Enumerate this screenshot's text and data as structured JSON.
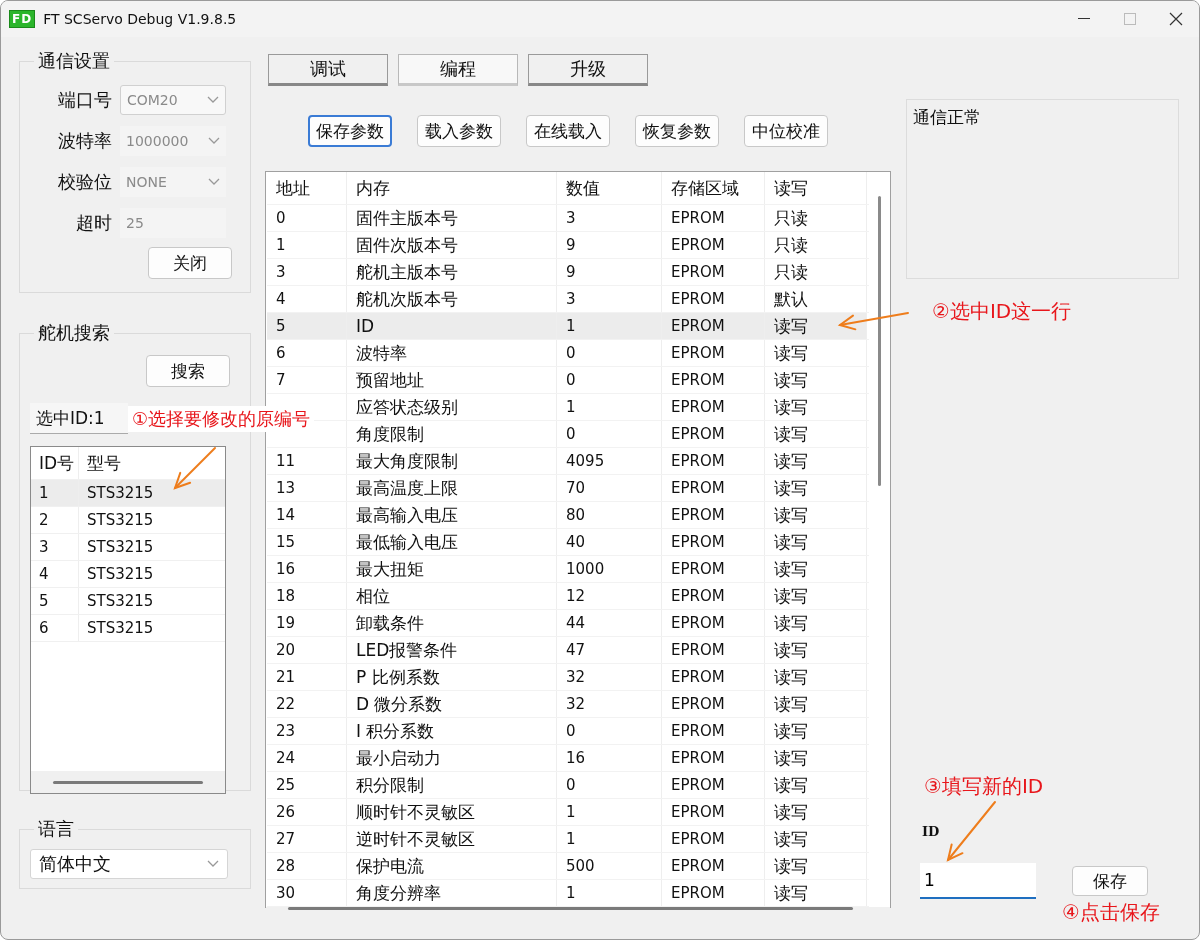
{
  "window": {
    "logo": "FD",
    "title": "FT SCServo Debug V1.9.8.5"
  },
  "comm_settings": {
    "title": "通信设置",
    "fields": [
      {
        "label": "端口号",
        "value": "COM20",
        "kind": "dropdown",
        "disabled": false
      },
      {
        "label": "波特率",
        "value": "1000000",
        "kind": "dropdown",
        "disabled": true
      },
      {
        "label": "校验位",
        "value": "NONE",
        "kind": "dropdown",
        "disabled": true
      },
      {
        "label": "超时",
        "value": "25",
        "kind": "text",
        "disabled": true
      }
    ],
    "button": "关闭"
  },
  "servo_search": {
    "title": "舵机搜索",
    "button": "搜索",
    "selected_id": "选中ID:1",
    "columns": [
      "ID号",
      "型号"
    ],
    "rows": [
      {
        "id": "1",
        "model": "STS3215",
        "selected": true
      },
      {
        "id": "2",
        "model": "STS3215",
        "selected": false
      },
      {
        "id": "3",
        "model": "STS3215",
        "selected": false
      },
      {
        "id": "4",
        "model": "STS3215",
        "selected": false
      },
      {
        "id": "5",
        "model": "STS3215",
        "selected": false
      },
      {
        "id": "6",
        "model": "STS3215",
        "selected": false
      }
    ]
  },
  "language": {
    "title": "语言",
    "value": "简体中文"
  },
  "tabs": [
    {
      "label": "调试",
      "selected": false
    },
    {
      "label": "编程",
      "selected": true
    },
    {
      "label": "升级",
      "selected": false
    }
  ],
  "actions": [
    {
      "label": "保存参数",
      "focused": true
    },
    {
      "label": "载入参数",
      "focused": false
    },
    {
      "label": "在线载入",
      "focused": false
    },
    {
      "label": "恢复参数",
      "focused": false
    },
    {
      "label": "中位校准",
      "focused": false
    }
  ],
  "table": {
    "columns": [
      "地址",
      "内存",
      "数值",
      "存储区域",
      "读写"
    ],
    "rows": [
      {
        "address": "0",
        "memory": "固件主版本号",
        "value": "3",
        "area": "EPROM",
        "access": "只读",
        "selected": false
      },
      {
        "address": "1",
        "memory": "固件次版本号",
        "value": "9",
        "area": "EPROM",
        "access": "只读",
        "selected": false
      },
      {
        "address": "3",
        "memory": "舵机主版本号",
        "value": "9",
        "area": "EPROM",
        "access": "只读",
        "selected": false
      },
      {
        "address": "4",
        "memory": "舵机次版本号",
        "value": "3",
        "area": "EPROM",
        "access": "默认",
        "selected": false
      },
      {
        "address": "5",
        "memory": "ID",
        "value": "1",
        "area": "EPROM",
        "access": "读写",
        "selected": true
      },
      {
        "address": "6",
        "memory": "波特率",
        "value": "0",
        "area": "EPROM",
        "access": "读写",
        "selected": false
      },
      {
        "address": "7",
        "memory": "预留地址",
        "value": "0",
        "area": "EPROM",
        "access": "读写",
        "selected": false
      },
      {
        "memory": "应答状态级别",
        "value": "1",
        "area": "EPROM",
        "access": "读写",
        "selected": false
      },
      {
        "memory": "角度限制",
        "value": "0",
        "area": "EPROM",
        "access": "读写",
        "selected": false
      },
      {
        "address": "11",
        "memory": "最大角度限制",
        "value": "4095",
        "area": "EPROM",
        "access": "读写",
        "selected": false
      },
      {
        "address": "13",
        "memory": "最高温度上限",
        "value": "70",
        "area": "EPROM",
        "access": "读写",
        "selected": false
      },
      {
        "address": "14",
        "memory": "最高输入电压",
        "value": "80",
        "area": "EPROM",
        "access": "读写",
        "selected": false
      },
      {
        "address": "15",
        "memory": "最低输入电压",
        "value": "40",
        "area": "EPROM",
        "access": "读写",
        "selected": false
      },
      {
        "address": "16",
        "memory": "最大扭矩",
        "value": "1000",
        "area": "EPROM",
        "access": "读写",
        "selected": false
      },
      {
        "address": "18",
        "memory": "相位",
        "value": "12",
        "area": "EPROM",
        "access": "读写",
        "selected": false
      },
      {
        "address": "19",
        "memory": "卸载条件",
        "value": "44",
        "area": "EPROM",
        "access": "读写",
        "selected": false
      },
      {
        "address": "20",
        "memory": "LED报警条件",
        "value": "47",
        "area": "EPROM",
        "access": "读写",
        "selected": false
      },
      {
        "address": "21",
        "memory": "P 比例系数",
        "value": "32",
        "area": "EPROM",
        "access": "读写",
        "selected": false
      },
      {
        "address": "22",
        "memory": "D 微分系数",
        "value": "32",
        "area": "EPROM",
        "access": "读写",
        "selected": false
      },
      {
        "address": "23",
        "memory": "I 积分系数",
        "value": "0",
        "area": "EPROM",
        "access": "读写",
        "selected": false
      },
      {
        "address": "24",
        "memory": "最小启动力",
        "value": "16",
        "area": "EPROM",
        "access": "读写",
        "selected": false
      },
      {
        "address": "25",
        "memory": "积分限制",
        "value": "0",
        "area": "EPROM",
        "access": "读写",
        "selected": false
      },
      {
        "address": "26",
        "memory": "顺时针不灵敏区",
        "value": "1",
        "area": "EPROM",
        "access": "读写",
        "selected": false
      },
      {
        "address": "27",
        "memory": "逆时针不灵敏区",
        "value": "1",
        "area": "EPROM",
        "access": "读写",
        "selected": false
      },
      {
        "address": "28",
        "memory": "保护电流",
        "value": "500",
        "area": "EPROM",
        "access": "读写",
        "selected": false
      },
      {
        "address": "30",
        "memory": "角度分辨率",
        "value": "1",
        "area": "EPROM",
        "access": "读写",
        "selected": false
      }
    ]
  },
  "status": "通信正常",
  "id_editor": {
    "label": "ID",
    "value": "1",
    "button": "保存"
  },
  "annotations": [
    "①选择要修改的原编号",
    "②选中ID这一行",
    "③填写新的ID",
    "④点击保存"
  ]
}
